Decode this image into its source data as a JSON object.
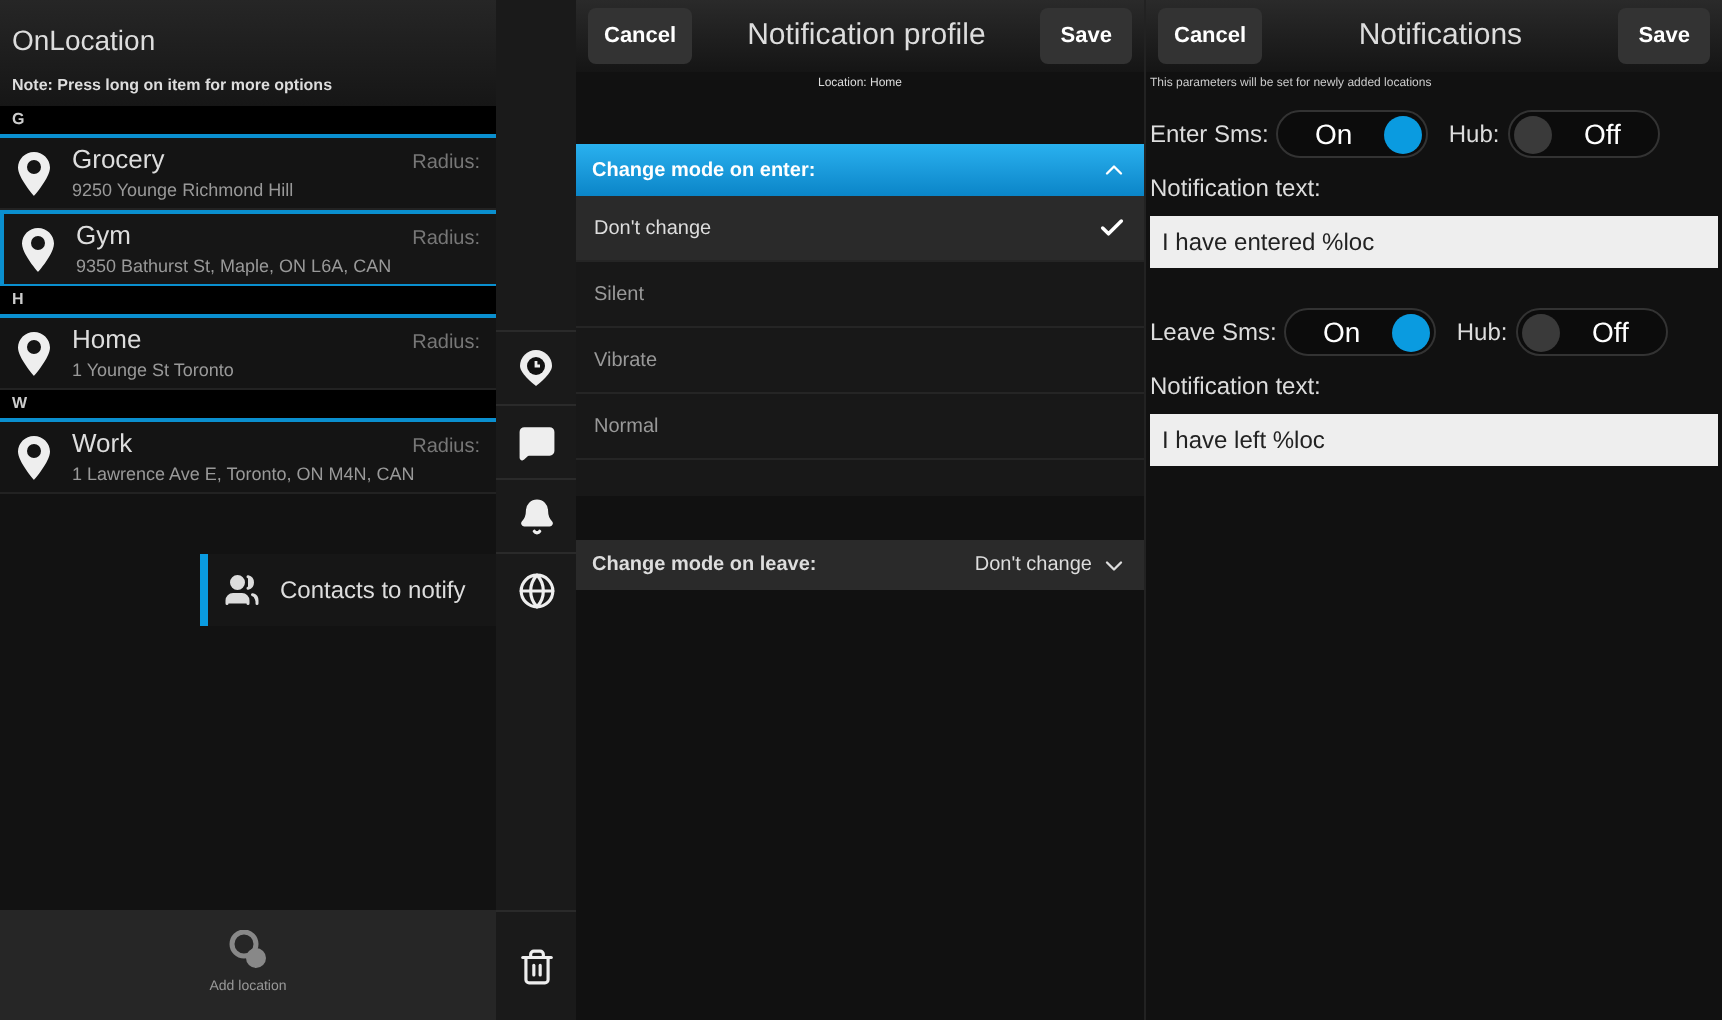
{
  "locations": {
    "title": "OnLocation",
    "note": "Note: Press long on item for more options",
    "sections": [
      {
        "letter": "G",
        "items": [
          {
            "name": "Grocery",
            "address": "9250 Younge Richmond Hill",
            "radius": "Radius:",
            "selected": false
          },
          {
            "name": "Gym",
            "address": "9350 Bathurst St, Maple, ON L6A, CAN",
            "radius": "Radius:",
            "selected": true
          }
        ]
      },
      {
        "letter": "H",
        "items": [
          {
            "name": "Home",
            "address": "1 Younge St Toronto",
            "radius": "Radius:",
            "selected": false
          }
        ]
      },
      {
        "letter": "W",
        "items": [
          {
            "name": "Work",
            "address": "1 Lawrence Ave E, Toronto, ON M4N, CAN",
            "radius": "Radius:",
            "selected": false
          }
        ]
      }
    ],
    "tooltip": "Contacts to notify",
    "add_button": "Add location"
  },
  "notification_profile": {
    "cancel": "Cancel",
    "title": "Notification profile",
    "save": "Save",
    "location": "Location: Home",
    "enter_dropdown": {
      "label": "Change mode on enter:",
      "expanded": true,
      "options": [
        {
          "label": "Don't change",
          "selected": true
        },
        {
          "label": "Silent",
          "selected": false
        },
        {
          "label": "Vibrate",
          "selected": false
        },
        {
          "label": "Normal",
          "selected": false
        }
      ]
    },
    "leave_dropdown": {
      "label": "Change mode on leave:",
      "value": "Don't change",
      "expanded": false
    }
  },
  "notifications": {
    "cancel": "Cancel",
    "title": "Notifications",
    "save": "Save",
    "note": "This parameters will be set for newly added locations",
    "groups": [
      {
        "sms_label": "Enter Sms:",
        "sms_on": true,
        "sms_state": "On",
        "hub_label": "Hub:",
        "hub_on": false,
        "hub_state": "Off",
        "text_label": "Notification text:",
        "text": "I have entered %loc"
      },
      {
        "sms_label": "Leave Sms:",
        "sms_on": true,
        "sms_state": "On",
        "hub_label": "Hub:",
        "hub_on": false,
        "hub_state": "Off",
        "text_label": "Notification text:",
        "text": "I have left %loc"
      }
    ]
  }
}
